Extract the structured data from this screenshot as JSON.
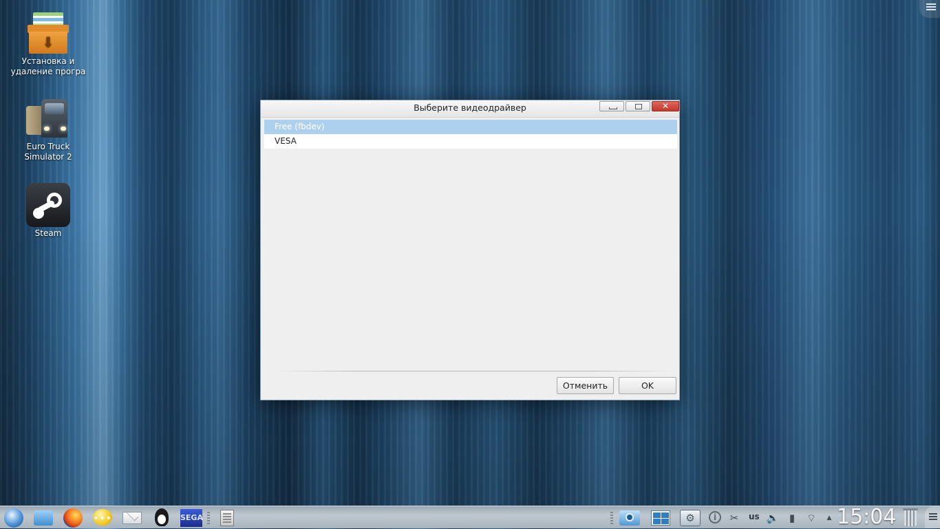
{
  "desktop": {
    "icons": [
      {
        "label_line1": "Установка и",
        "label_line2": "удаление програ",
        "icon": "package-box-icon"
      },
      {
        "label_line1": "Euro Truck",
        "label_line2": "Simulator 2",
        "icon": "truck-icon"
      },
      {
        "label_line1": "Steam",
        "label_line2": "",
        "icon": "steam-icon"
      }
    ]
  },
  "dialog": {
    "title": "Выберите видеодрайвер",
    "items": [
      {
        "label": "Free (fbdev)",
        "selected": true
      },
      {
        "label": "VESA",
        "selected": false
      }
    ],
    "cancel_label": "Отменить",
    "ok_label": "OK",
    "close_glyph": "✕"
  },
  "colors": {
    "selection": "#aed0ef",
    "close_button": "#c9463a"
  },
  "taskbar": {
    "launchers": [
      "kde-menu-icon",
      "file-manager-icon",
      "firefox-icon",
      "chat-icon",
      "mail-icon",
      "tux-icon",
      "sega-emulator-icon",
      "text-document-icon"
    ],
    "sega_label": "SEGA",
    "tray": [
      "screenshot-icon",
      "window-grid-icon",
      "system-settings-icon",
      "info-icon",
      "scissors-icon",
      "volume-icon",
      "battery-icon",
      "wifi-icon",
      "tray-expand-icon"
    ],
    "scissors_glyph": "✂",
    "volume_glyph": "🔈",
    "battery_glyph": "▮",
    "wifi_glyph": "⌔",
    "expand_glyph": "▲",
    "info_glyph": "i",
    "keyboard_layout": "us",
    "clock": "15:04"
  }
}
